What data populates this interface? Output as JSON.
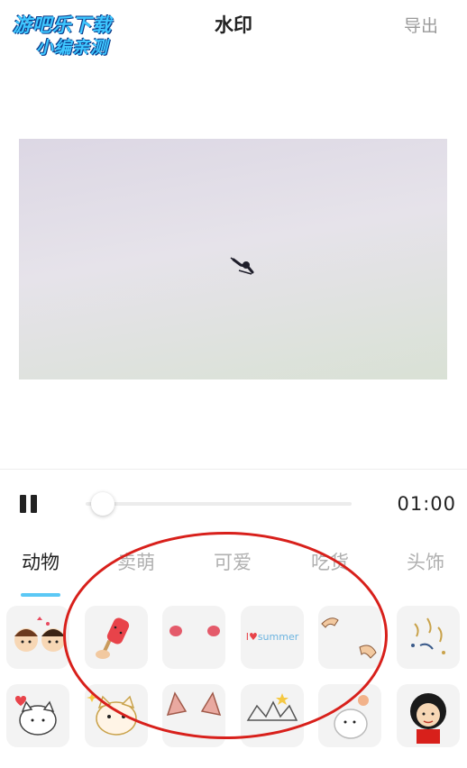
{
  "watermark": {
    "line1": "游吧乐下载",
    "line2": "小编亲测"
  },
  "header": {
    "title": "水印",
    "export_label": "导出"
  },
  "player": {
    "time": "01:00",
    "progress": 0.0
  },
  "tabs": [
    {
      "label": "动物",
      "active": true
    },
    {
      "label": "卖萌",
      "active": false
    },
    {
      "label": "可爱",
      "active": false
    },
    {
      "label": "吃货",
      "active": false
    },
    {
      "label": "头饰",
      "active": false
    }
  ],
  "stickers": {
    "row1": [
      "kids-sticker",
      "watermelon-popsicle-sticker",
      "blush-cheeks-sticker",
      "summer-text-sticker",
      "hands-sticker",
      "confetti-sticker"
    ],
    "row1_summer_text": "summer",
    "row2": [
      "cat-hearts-sticker",
      "cat-face-sticker",
      "cat-ears-sticker",
      "crown-sticker",
      "rabbit-sticker",
      "girl-sticker"
    ]
  },
  "colors": {
    "accent": "#5bc8f5",
    "annotation": "#d8201b"
  }
}
